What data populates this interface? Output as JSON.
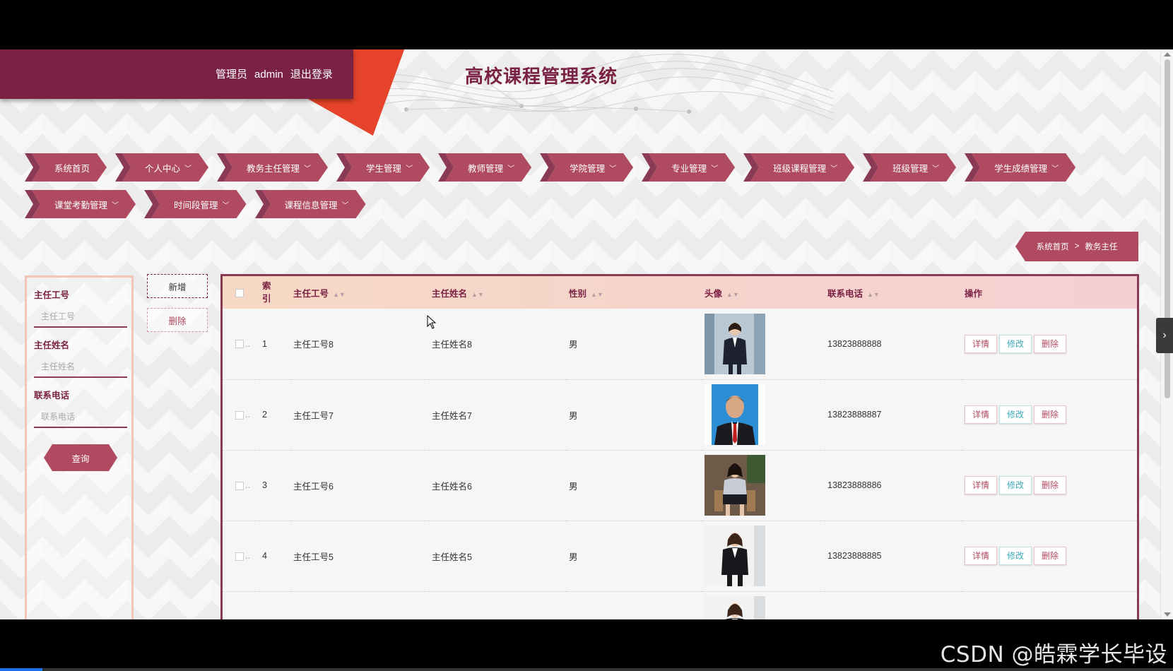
{
  "header": {
    "role": "管理员",
    "username": "admin",
    "logout": "退出登录",
    "title": "高校课程管理系统"
  },
  "nav": {
    "row1": [
      {
        "label": "系统首页",
        "dropdown": false
      },
      {
        "label": "个人中心",
        "dropdown": true
      },
      {
        "label": "教务主任管理",
        "dropdown": true
      },
      {
        "label": "学生管理",
        "dropdown": true
      },
      {
        "label": "教师管理",
        "dropdown": true
      },
      {
        "label": "学院管理",
        "dropdown": true
      },
      {
        "label": "专业管理",
        "dropdown": true
      },
      {
        "label": "班级课程管理",
        "dropdown": true
      },
      {
        "label": "班级管理",
        "dropdown": true
      },
      {
        "label": "学生成绩管理",
        "dropdown": true
      }
    ],
    "row2": [
      {
        "label": "课堂考勤管理",
        "dropdown": true
      },
      {
        "label": "时间段管理",
        "dropdown": true
      },
      {
        "label": "课程信息管理",
        "dropdown": true
      }
    ]
  },
  "breadcrumb": {
    "home": "系统首页",
    "separator": ">",
    "current": "教务主任"
  },
  "search": {
    "id_label": "主任工号",
    "id_placeholder": "主任工号",
    "name_label": "主任姓名",
    "name_placeholder": "主任姓名",
    "phone_label": "联系电话",
    "phone_placeholder": "联系电话",
    "query_button": "查询"
  },
  "actions": {
    "add": "新增",
    "delete": "删除"
  },
  "table": {
    "headers": {
      "index": "索引",
      "id": "主任工号",
      "name": "主任姓名",
      "gender": "性别",
      "avatar": "头像",
      "phone": "联系电话",
      "ops": "操作"
    },
    "rows": [
      {
        "index": "1",
        "id": "主任工号8",
        "name": "主任姓名8",
        "gender": "男",
        "phone": "13823888888"
      },
      {
        "index": "2",
        "id": "主任工号7",
        "name": "主任姓名7",
        "gender": "男",
        "phone": "13823888887"
      },
      {
        "index": "3",
        "id": "主任工号6",
        "name": "主任姓名6",
        "gender": "男",
        "phone": "13823888886"
      },
      {
        "index": "4",
        "id": "主任工号5",
        "name": "主任姓名5",
        "gender": "男",
        "phone": "13823888885"
      }
    ],
    "op_labels": {
      "detail": "详情",
      "edit": "修改",
      "delete": "删除"
    }
  },
  "watermark": "CSDN @皓霖学长毕设",
  "colors": {
    "primary": "#b04a60",
    "dark": "#7a2244",
    "accent": "#e5432a"
  }
}
